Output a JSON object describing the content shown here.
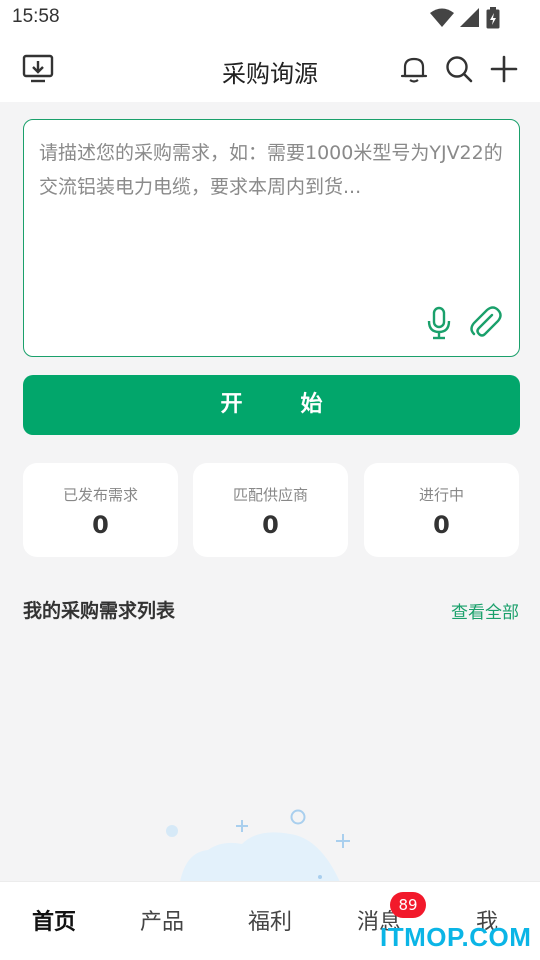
{
  "status_bar": {
    "time": "15:58"
  },
  "app_bar": {
    "title": "采购询源"
  },
  "request": {
    "placeholder": "请描述您的采购需求，如：需要1000米型号为YJV22的交流铝装电力电缆，要求本周内到货..."
  },
  "start_button": {
    "label": "开始"
  },
  "stats": [
    {
      "label": "已发布需求",
      "value": "0"
    },
    {
      "label": "匹配供应商",
      "value": "0"
    },
    {
      "label": "进行中",
      "value": "0"
    }
  ],
  "list": {
    "title": "我的采购需求列表",
    "view_all": "查看全部"
  },
  "tabs": [
    {
      "label": "首页"
    },
    {
      "label": "产品"
    },
    {
      "label": "福利"
    },
    {
      "label": "消息"
    },
    {
      "label": "我"
    }
  ],
  "badge": {
    "count": "89"
  },
  "watermark": {
    "text": "ITMOP.COM"
  },
  "colors": {
    "accent": "#02a66b",
    "badge": "#f2192b",
    "background": "#f4f4f5"
  },
  "icons": [
    "download-screen-icon",
    "bell-icon",
    "search-icon",
    "plus-icon",
    "microphone-icon",
    "paperclip-icon",
    "wifi-icon",
    "signal-icon",
    "battery-icon"
  ]
}
